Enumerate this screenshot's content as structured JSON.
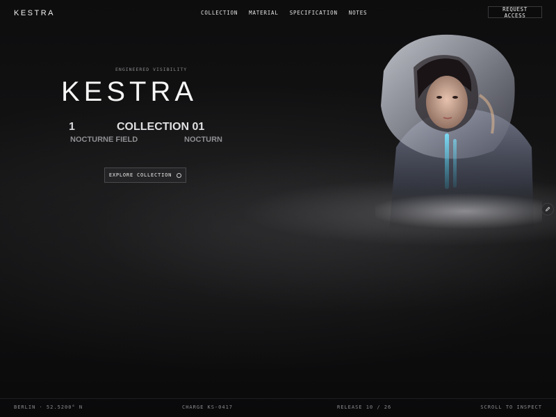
{
  "header": {
    "logo": "KESTRA",
    "nav": [
      "COLLECTION",
      "MATERIAL",
      "SPECIFICATION",
      "NOTES"
    ],
    "cta_label": "REQUEST ACCESS"
  },
  "hero": {
    "eyebrow": "ENGINEERED VISIBILITY",
    "title": "KESTRA",
    "ticker_number": "1",
    "ticker_collection": "COLLECTION 01",
    "ticker_sub_left": "NOCTURNE FIELD",
    "ticker_sub_right": "NOCTURN",
    "explore_label": "EXPLORE COLLECTION"
  },
  "footer": {
    "location": "BERLIN · 52.5200° N",
    "charge": "CHARGE KS-0417",
    "release": "RELEASE 10 / 26",
    "scroll": "SCROLL TO INSPECT"
  },
  "icons": {
    "explore": "circle-icon",
    "edit": "pencil-icon"
  },
  "colors": {
    "background": "#0b0b0c",
    "text": "#f5f5f5",
    "muted": "#8c8c90",
    "button_bg": "#242426"
  }
}
